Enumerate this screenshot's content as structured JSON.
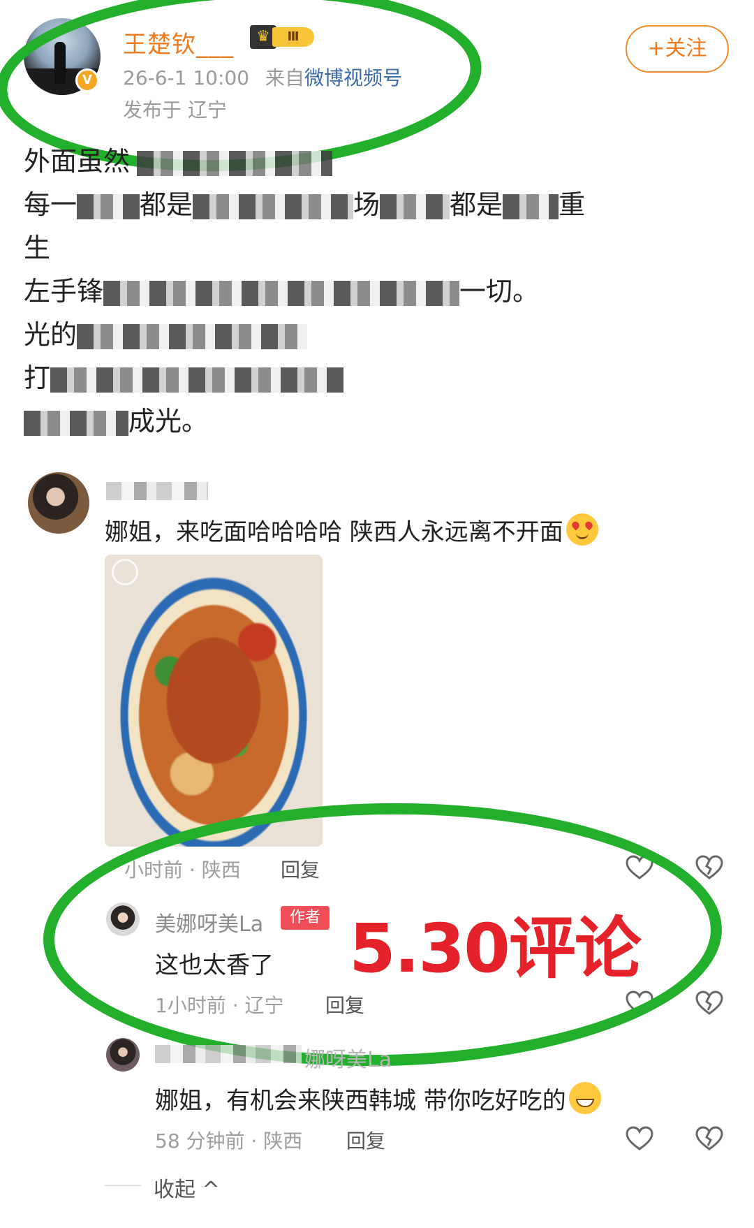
{
  "post": {
    "username": "王楚钦___",
    "rank_level": "Ⅲ",
    "verified_badge": "V",
    "time": "26-6-1 10:00",
    "source_prefix": "来自",
    "source": "微博视频号",
    "location": "发布于 辽宁",
    "follow_label": "+关注",
    "lines": [
      {
        "pre": "外面虽然",
        "post": ""
      },
      {
        "pre": "每一",
        "mid": "都是",
        "mid2": "场",
        "mid3": "都是",
        "post": "重"
      },
      {
        "pre": "生",
        "post": ""
      },
      {
        "pre": "左手锋",
        "post": "一切。"
      },
      {
        "pre": "光的",
        "post": ""
      },
      {
        "pre": "打",
        "post": ""
      },
      {
        "pre": "",
        "post": "成光。"
      }
    ]
  },
  "comments": [
    {
      "text": "娜姐，来吃面哈哈哈哈 陕西人永远离不开面",
      "emoji": "heart-eyes-emoji",
      "meta": "小时前 · 陕西",
      "reply_label": "回复"
    },
    {
      "name": "美娜呀美La",
      "author_tag": "作者",
      "text": "这也太香了",
      "meta": "1小时前 · 辽宁",
      "reply_label": "回复"
    },
    {
      "name_suffix": "娜呀美La",
      "text": "娜姐，有机会来陕西韩城 带你吃好吃的",
      "emoji": "grin-emoji",
      "meta": "58 分钟前 · 陕西",
      "reply_label": "回复"
    }
  ],
  "collapse_label": "收起 ^",
  "annotation": "5.30评论",
  "colors": {
    "accent_orange": "#ee7b20",
    "annotation_red": "#e5222a",
    "marker_green": "#22b02c",
    "author_tag": "#f04e56"
  }
}
